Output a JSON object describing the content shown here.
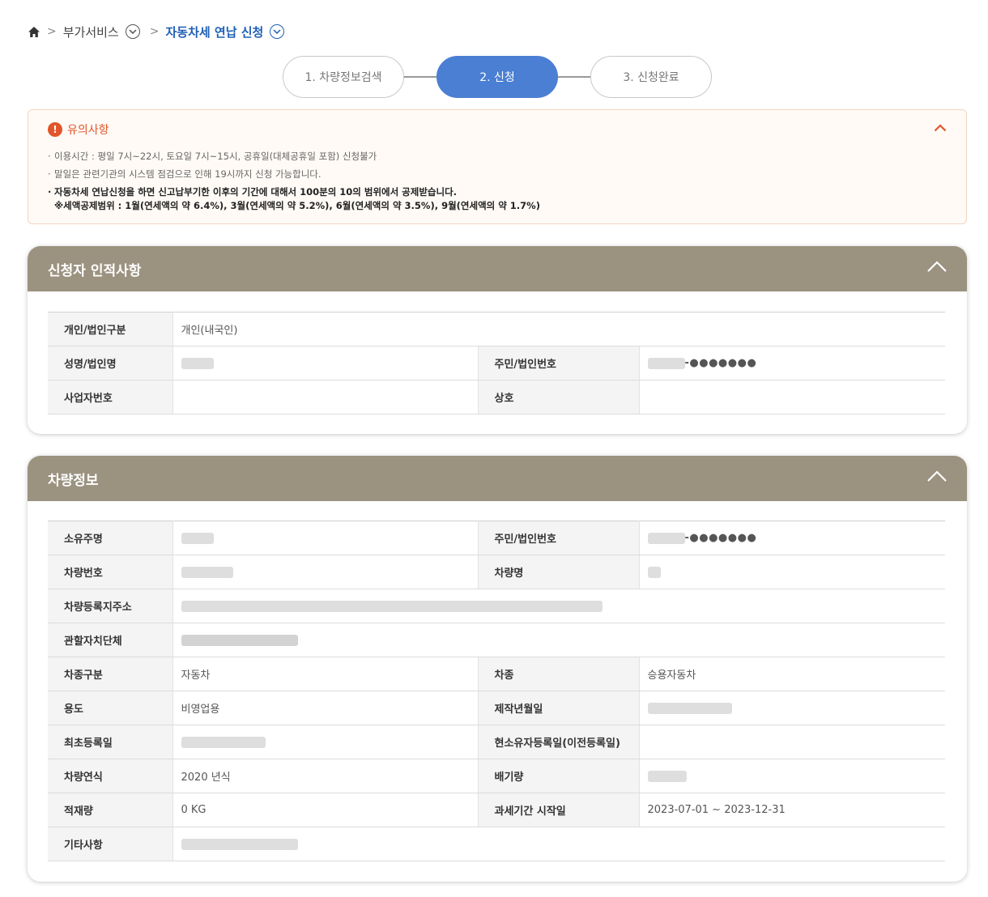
{
  "breadcrumb": {
    "items": [
      "부가서비스",
      "자동차세 연납 신청"
    ]
  },
  "steps": [
    {
      "label": "1. 차량정보검색",
      "active": false
    },
    {
      "label": "2. 신청",
      "active": true
    },
    {
      "label": "3. 신청완료",
      "active": false
    }
  ],
  "notice": {
    "title": "유의사항",
    "items": [
      "이용시간 : 평일 7시~22시, 토요일 7시~15시, 공휴일(대체공휴일 포함) 신청불가",
      "말일은 관련기관의 시스템 점검으로 인해 19시까지 신청 가능합니다."
    ],
    "strong_line1": "자동차세 연납신청을 하면 신고납부기한 이후의 기간에 대해서 100분의 10의 범위에서 공제받습니다.",
    "strong_line2": "※세액공제범위 : 1월(연세액의 약 6.4%), 3월(연세액의 약 5.2%), 6월(연세액의 약 3.5%), 9월(연세액의 약 1.7%)"
  },
  "applicant": {
    "title": "신청자 인적사항",
    "labels": {
      "type": "개인/법인구분",
      "name": "성명/법인명",
      "rrn": "주민/법인번호",
      "biz_no": "사업자번호",
      "company": "상호"
    },
    "values": {
      "type": "개인(내국인)",
      "rrn_mask": "-●●●●●●●"
    }
  },
  "vehicle": {
    "title": "차량정보",
    "labels": {
      "owner": "소유주명",
      "rrn": "주민/법인번호",
      "plate": "차량번호",
      "model": "차량명",
      "address": "차량등록지주소",
      "district": "관할자치단체",
      "category": "차종구분",
      "car_type": "차종",
      "usage": "용도",
      "manufacture_date": "제작년월일",
      "first_reg": "최초등록일",
      "owner_reg": "현소유자등록일(이전등록일)",
      "model_year": "차량연식",
      "displacement": "배기량",
      "load": "적재량",
      "tax_period": "과세기간 시작일",
      "etc": "기타사항"
    },
    "values": {
      "rrn_mask": "-●●●●●●●",
      "category": "자동차",
      "car_type": "승용자동차",
      "usage": "비영업용",
      "model_year": "2020 년식",
      "load": "0 KG",
      "tax_period": "2023-07-01 ~ 2023-12-31"
    }
  },
  "colors": {
    "accent": "#4a7fd3",
    "panel_header": "#9b9280",
    "notice_red": "#e2552a",
    "breadcrumb_blue": "#1f5fb5"
  }
}
